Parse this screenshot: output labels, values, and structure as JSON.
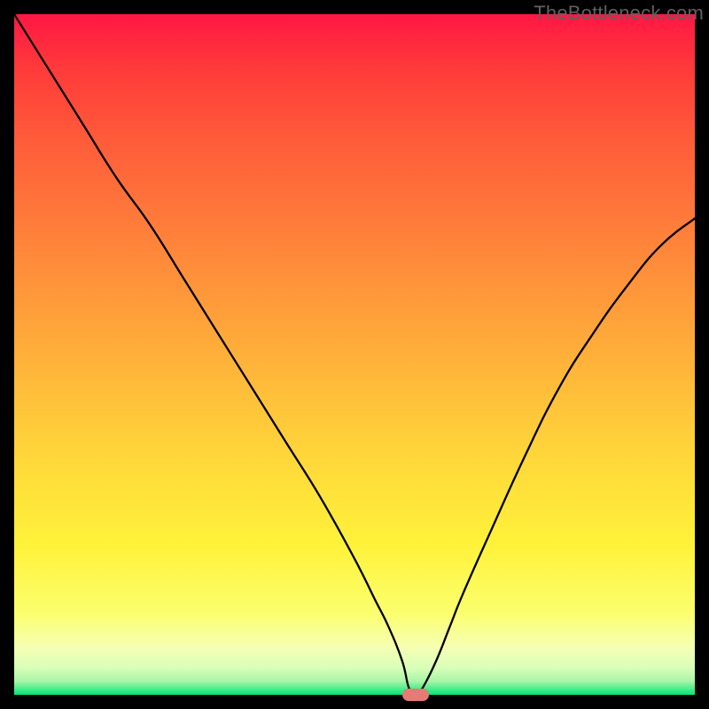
{
  "watermark": "TheBottleneck.com",
  "colors": {
    "top": "#ff1744",
    "mid": "#ffd93a",
    "bottom": "#00e676",
    "curve": "#000000",
    "marker": "#e77a74",
    "frame": "#000000"
  },
  "chart_data": {
    "type": "line",
    "title": "",
    "xlabel": "",
    "ylabel": "",
    "xlim": [
      0,
      100
    ],
    "ylim": [
      0,
      100
    ],
    "grid": false,
    "legend": false,
    "marker": {
      "x": 59,
      "y": 0
    },
    "series": [
      {
        "name": "curve",
        "x": [
          0,
          5,
          10,
          15,
          20,
          25,
          30,
          35,
          40,
          45,
          50,
          53,
          55,
          57,
          58,
          59,
          60,
          62,
          64,
          66,
          70,
          75,
          80,
          85,
          90,
          95,
          100
        ],
        "values": [
          100,
          92,
          84,
          76,
          69,
          61,
          53,
          45,
          37,
          29,
          20,
          14,
          10,
          5,
          1,
          0,
          1,
          5,
          10,
          15,
          24,
          35,
          45,
          53,
          60,
          66,
          70
        ]
      }
    ]
  }
}
